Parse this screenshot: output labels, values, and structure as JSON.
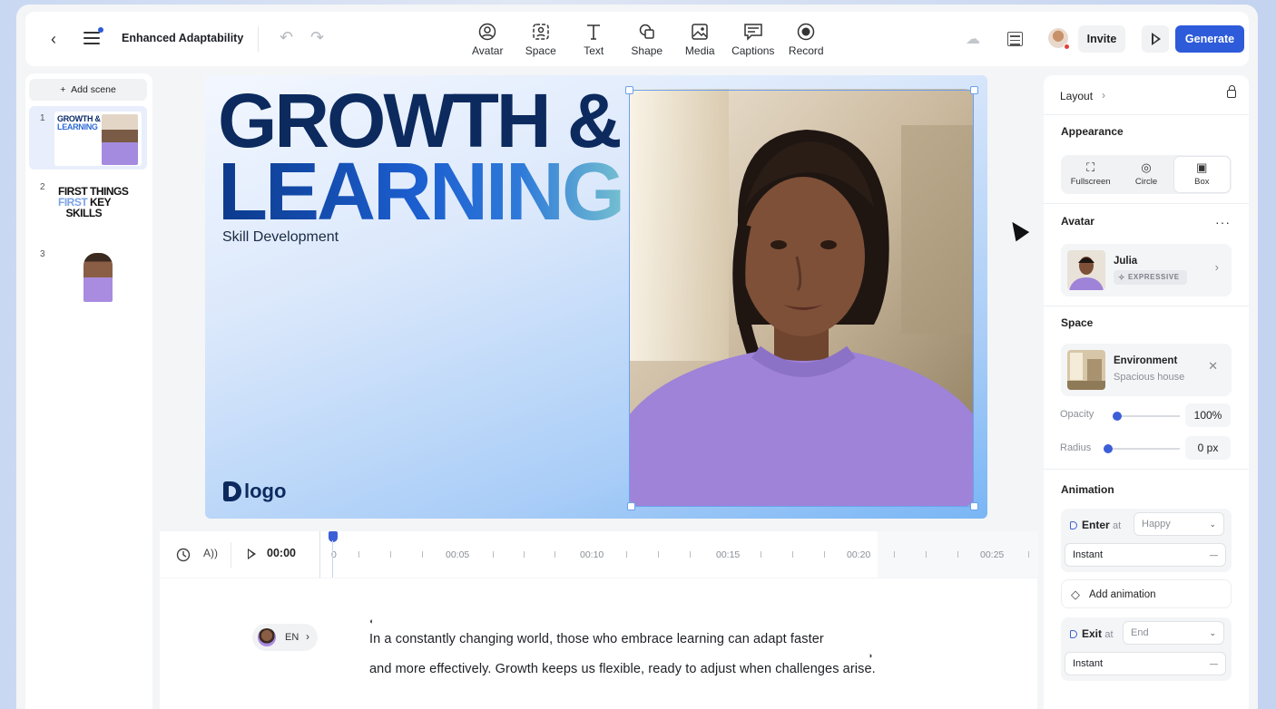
{
  "topbar": {
    "back_icon": "chevron-left-icon",
    "menu_icon": "hamburger-menu-icon",
    "project_title": "Enhanced Adaptability",
    "tools": [
      {
        "label": "Avatar",
        "icon": "avatar-icon"
      },
      {
        "label": "Space",
        "icon": "space-icon"
      },
      {
        "label": "Text",
        "icon": "text-icon"
      },
      {
        "label": "Shape",
        "icon": "shape-icon"
      },
      {
        "label": "Media",
        "icon": "media-icon"
      },
      {
        "label": "Captions",
        "icon": "captions-icon"
      },
      {
        "label": "Record",
        "icon": "record-icon"
      }
    ],
    "invite_label": "Invite",
    "generate_label": "Generate",
    "accent_color": "#2e5bd9"
  },
  "scenes": {
    "add_label": "Add scene",
    "items": [
      {
        "number": "1",
        "line1": "GROWTH &",
        "line2": "LEARNING"
      },
      {
        "number": "2",
        "line1": "FIRST THINGS",
        "line2": "FIRST",
        "line3": "KEY",
        "line4": "SKILLS"
      },
      {
        "number": "3"
      }
    ]
  },
  "canvas": {
    "title_line1": "GROWTH &",
    "title_line2": "LEARNING",
    "subtitle": "Skill Development",
    "logo_text": "logo"
  },
  "timeline": {
    "current_time": "00:00",
    "ticks": [
      "0",
      "00:05",
      "00:10",
      "00:15",
      "00:20",
      "00:25"
    ]
  },
  "script": {
    "speaker_lang": "EN",
    "line1": "In a constantly changing world, those who embrace learning can adapt faster",
    "line2": "and more effectively. Growth keeps us flexible, ready to adjust when challenges arise."
  },
  "panel": {
    "layout_label": "Layout",
    "appearance": {
      "title": "Appearance",
      "options": [
        {
          "label": "Fullscreen",
          "icon": "fullscreen-icon"
        },
        {
          "label": "Circle",
          "icon": "circle-icon"
        },
        {
          "label": "Box",
          "icon": "box-icon",
          "selected": true
        }
      ]
    },
    "avatar": {
      "title": "Avatar",
      "name": "Julia",
      "badge": "EXPRESSIVE"
    },
    "space": {
      "title": "Space",
      "name": "Environment",
      "sub": "Spacious house",
      "opacity_label": "Opacity",
      "opacity_value": "100%",
      "opacity_level": 0,
      "radius_label": "Radius",
      "radius_value": "0 px",
      "radius_level": 0
    },
    "animation": {
      "title": "Animation",
      "enter_label": "Enter",
      "at_label": "at",
      "enter_at_value": "Happy",
      "enter_style": "Instant",
      "add_label": "Add animation",
      "exit_label": "Exit",
      "exit_at_value": "End",
      "exit_style": "Instant"
    }
  }
}
